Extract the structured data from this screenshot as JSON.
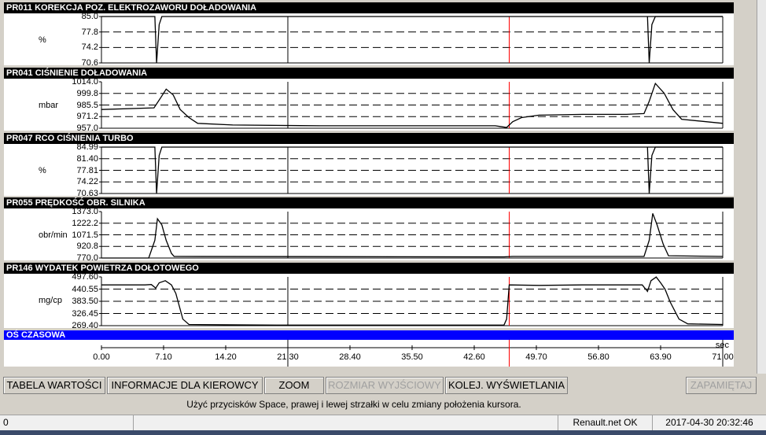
{
  "panels": [
    {
      "code": "PR011",
      "title": "PR011  KOREKCJA POZ. ELEKTROZAWORU DOŁADOWANIA",
      "unit": "%",
      "ticks": [
        "85.0",
        "77.8",
        "74.2",
        "70.6"
      ],
      "ymin": 70.6,
      "ymax": 85.0
    },
    {
      "code": "PR041",
      "title": "PR041  CIŚNIENIE DOŁADOWANIA",
      "unit": "mbar",
      "ticks": [
        "1014.0",
        "999.8",
        "985.5",
        "971.2",
        "957.0"
      ],
      "ymin": 957.0,
      "ymax": 1014.0
    },
    {
      "code": "PR047",
      "title": "PR047  RCO CIŚNIENIA TURBO",
      "unit": "%",
      "ticks": [
        "84.99",
        "81.40",
        "77.81",
        "74.22",
        "70.63"
      ],
      "ymin": 70.63,
      "ymax": 84.99
    },
    {
      "code": "PR055",
      "title": "PR055  PRĘDKOŚĆ OBR. SILNIKA",
      "unit": "obr/min",
      "ticks": [
        "1373.0",
        "1222.2",
        "1071.5",
        "920.8",
        "770.0"
      ],
      "ymin": 770.0,
      "ymax": 1373.0
    },
    {
      "code": "PR146",
      "title": "PR146  WYDATEK POWIETRZA DOŁOTOWEGO",
      "unit": "mg/cp",
      "ticks": [
        "497.60",
        "440.55",
        "383.50",
        "326.45",
        "269.40"
      ],
      "ymin": 269.4,
      "ymax": 497.6
    }
  ],
  "chart_data": {
    "type": "line",
    "x_axis_label": "OŚ CZASOWA",
    "x_unit": "sec",
    "x_ticks": [
      "0.00",
      "7.10",
      "14.20",
      "21.30",
      "28.40",
      "35.50",
      "42.60",
      "49.70",
      "56.80",
      "63.90",
      "71.00"
    ],
    "xlim": [
      0,
      71.0
    ],
    "cursor_x": 46.6,
    "series": [
      {
        "name": "PR011",
        "x": [
          0,
          6.1,
          6.3,
          6.6,
          6.9,
          71
        ],
        "y": [
          85.0,
          85.0,
          70.6,
          82.5,
          85.0,
          85.0
        ],
        "x2": [
          62.4,
          62.6,
          62.9,
          63.3,
          71
        ],
        "y2": [
          85.0,
          70.6,
          82.5,
          85.0,
          85.0
        ]
      },
      {
        "name": "PR041",
        "x": [
          0,
          6.0,
          6.8,
          7.4,
          8.2,
          9.0,
          10.0,
          11.0,
          15,
          25,
          35,
          45,
          46.3,
          47.0,
          48.0,
          50,
          55,
          60,
          62.0,
          62.6,
          63.3,
          64.3,
          65.3,
          66.3,
          71
        ],
        "y": [
          980,
          982,
          995,
          1005,
          998,
          980,
          970,
          963,
          961,
          960,
          960,
          960,
          958,
          965,
          970,
          973,
          974,
          974,
          975,
          990,
          1012,
          1000,
          980,
          968,
          963
        ]
      },
      {
        "name": "PR047",
        "x": [
          0,
          6.1,
          6.3,
          6.6,
          6.9,
          71
        ],
        "y": [
          84.99,
          84.99,
          70.63,
          82.4,
          84.99,
          84.99
        ],
        "x2": [
          62.4,
          62.6,
          62.9,
          63.3,
          71
        ],
        "y2": [
          84.99,
          70.63,
          82.4,
          84.99,
          84.99
        ]
      },
      {
        "name": "PR055",
        "x": [
          0,
          5.4,
          6.1,
          6.4,
          6.9,
          7.4,
          8.0,
          8.3,
          46,
          47,
          62.0,
          62.6,
          63.0,
          63.5,
          64.2,
          64.8,
          71
        ],
        "y": [
          770,
          770,
          1000,
          1280,
          1200,
          1000,
          830,
          790,
          785,
          790,
          790,
          1000,
          1350,
          1200,
          950,
          800,
          790
        ]
      },
      {
        "name": "PR146",
        "x": [
          0,
          5.0,
          5.7,
          6.2,
          6.6,
          7.3,
          8.0,
          8.5,
          9.3,
          10.0,
          20,
          30,
          40,
          46.0,
          46.3,
          46.6,
          50,
          55,
          60,
          61.8,
          62.4,
          62.8,
          63.4,
          63.9,
          64.4,
          65.0,
          66.0,
          67.0,
          71
        ],
        "y": [
          460,
          460,
          462,
          445,
          470,
          480,
          460,
          420,
          300,
          275,
          272,
          272,
          272,
          272,
          300,
          460,
          458,
          460,
          460,
          460,
          430,
          480,
          497,
          470,
          440,
          380,
          300,
          278,
          275
        ]
      }
    ]
  },
  "toolbar": {
    "tabela": "TABELA WARTOŚCI",
    "informacje": "INFORMACJE DLA KIEROWCY",
    "zoom": "ZOOM",
    "rozmiar": "ROZMIAR WYJŚCIOWY",
    "kolej": "KOLEJ. WYŚWIETLANIA",
    "zapamietaj": "ZAPAMIĘTAJ"
  },
  "hint": "Użyć przycisków Space, prawej i lewej strzałki w celu zmiany położenia kursora.",
  "status": {
    "left": "0",
    "renault": "Renault.net OK",
    "datetime": "2017-04-30 20:32:46"
  }
}
